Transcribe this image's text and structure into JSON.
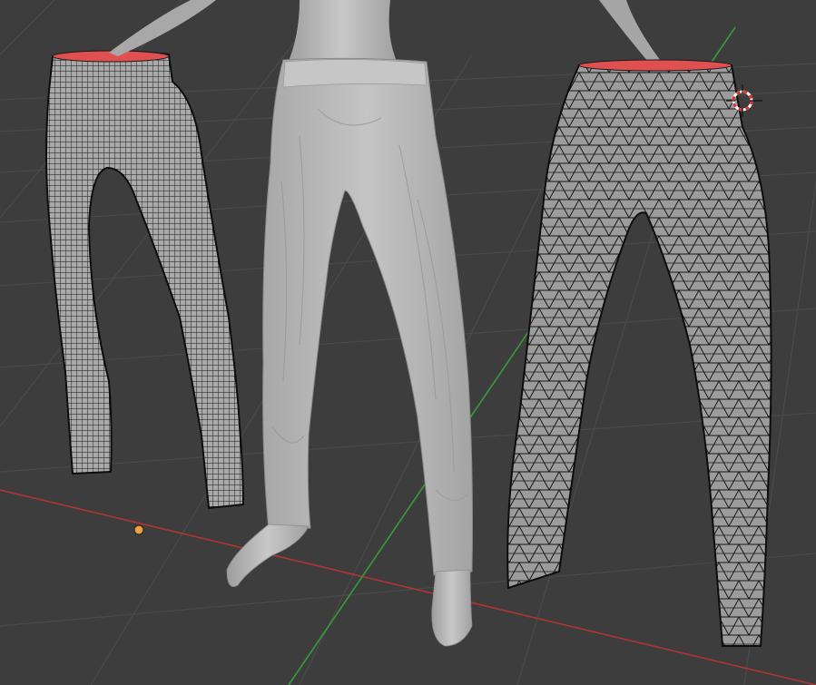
{
  "viewport": {
    "background": "#3d3d3d",
    "grid_color": "#4a4a4a",
    "x_axis_color": "#b03535",
    "y_axis_color": "#3a9a3a"
  },
  "objects": [
    {
      "name": "pants-quad-wireframe",
      "display": "wireframe",
      "topology": "quads",
      "waist_color": "#e05050"
    },
    {
      "name": "pants-sculpted",
      "display": "solid",
      "body_color": "#bdbdbd"
    },
    {
      "name": "pants-triangulated-wireframe",
      "display": "wireframe",
      "topology": "triangles",
      "waist_color": "#e05050"
    }
  ],
  "gizmos": {
    "origin_dot_color": "#f0a040",
    "cursor": "3d-cursor"
  }
}
